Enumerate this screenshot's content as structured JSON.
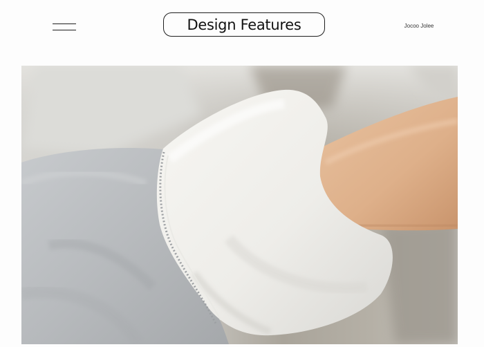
{
  "header": {
    "menu_icon": "hamburger-menu-icon",
    "title": "Design Features",
    "brand": "Jocoo Jolee"
  },
  "photo": {
    "subject": "sleeve-cuff-photo"
  },
  "colors": {
    "background": "#fdfdfd",
    "text": "#111111",
    "sweater_grey": "#b9bcbf",
    "fleece_white": "#f1f0ec",
    "skin": "#dfb38e"
  }
}
